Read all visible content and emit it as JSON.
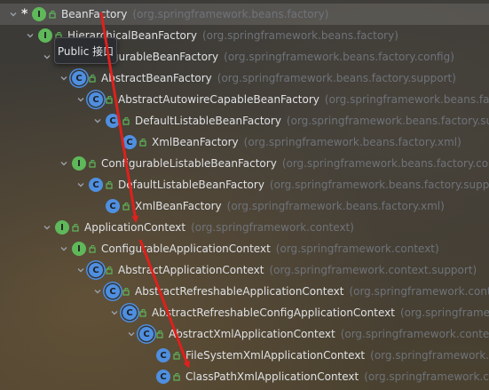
{
  "tooltip": {
    "text": "Public 接口"
  },
  "tree": [
    {
      "indent": 0,
      "chevron": "down",
      "star": true,
      "icon": "interface",
      "name": "BeanFactory",
      "package": "(org.springframework.beans.factory)",
      "selected": true
    },
    {
      "indent": 1,
      "chevron": "down",
      "star": false,
      "icon": "interface",
      "name": "HierarchicalBeanFactory",
      "package": "(org.springframework.beans.factory)",
      "selected": false
    },
    {
      "indent": 2,
      "chevron": "down",
      "star": false,
      "icon": "interface",
      "name": "ConfigurableBeanFactory",
      "package": "(org.springframework.beans.factory.config)",
      "selected": false
    },
    {
      "indent": 3,
      "chevron": "down",
      "star": false,
      "icon": "abstract",
      "name": "AbstractBeanFactory",
      "package": "(org.springframework.beans.factory.support)",
      "selected": false
    },
    {
      "indent": 4,
      "chevron": "down",
      "star": false,
      "icon": "abstract",
      "name": "AbstractAutowireCapableBeanFactory",
      "package": "(org.springframework.beans.factory.support)",
      "selected": false
    },
    {
      "indent": 5,
      "chevron": "down",
      "star": false,
      "icon": "class",
      "name": "DefaultListableBeanFactory",
      "package": "(org.springframework.beans.factory.support)",
      "selected": false
    },
    {
      "indent": 6,
      "chevron": "none",
      "star": false,
      "icon": "class",
      "name": "XmlBeanFactory",
      "package": "(org.springframework.beans.factory.xml)",
      "selected": false
    },
    {
      "indent": 3,
      "chevron": "down",
      "star": false,
      "icon": "interface",
      "name": "ConfigurableListableBeanFactory",
      "package": "(org.springframework.beans.factory.config)",
      "selected": false
    },
    {
      "indent": 4,
      "chevron": "down",
      "star": false,
      "icon": "class",
      "name": "DefaultListableBeanFactory",
      "package": "(org.springframework.beans.factory.support)",
      "selected": false
    },
    {
      "indent": 5,
      "chevron": "none",
      "star": false,
      "icon": "class",
      "name": "XmlBeanFactory",
      "package": "(org.springframework.beans.factory.xml)",
      "selected": false
    },
    {
      "indent": 2,
      "chevron": "down",
      "star": false,
      "icon": "interface",
      "name": "ApplicationContext",
      "package": "(org.springframework.context)",
      "selected": false
    },
    {
      "indent": 3,
      "chevron": "down",
      "star": false,
      "icon": "interface",
      "name": "ConfigurableApplicationContext",
      "package": "(org.springframework.context)",
      "selected": false
    },
    {
      "indent": 4,
      "chevron": "down",
      "star": false,
      "icon": "abstract",
      "name": "AbstractApplicationContext",
      "package": "(org.springframework.context.support)",
      "selected": false
    },
    {
      "indent": 5,
      "chevron": "down",
      "star": false,
      "icon": "abstract",
      "name": "AbstractRefreshableApplicationContext",
      "package": "(org.springframework.context.support)",
      "selected": false
    },
    {
      "indent": 6,
      "chevron": "down",
      "star": false,
      "icon": "abstract",
      "name": "AbstractRefreshableConfigApplicationContext",
      "package": "(org.springframework.context.support)",
      "selected": false
    },
    {
      "indent": 7,
      "chevron": "down",
      "star": false,
      "icon": "abstract",
      "name": "AbstractXmlApplicationContext",
      "package": "(org.springframework.context.support)",
      "selected": false
    },
    {
      "indent": 8,
      "chevron": "none",
      "star": false,
      "icon": "class",
      "name": "FileSystemXmlApplicationContext",
      "package": "(org.springframework.context.support)",
      "selected": false
    },
    {
      "indent": 8,
      "chevron": "none",
      "star": false,
      "icon": "class",
      "name": "ClassPathXmlApplicationContext",
      "package": "(org.springframework.context.support)",
      "selected": false
    }
  ],
  "colors": {
    "annotation_arrow": "#e0201c",
    "interface_icon": "#5fb85a",
    "class_icon": "#4f8fe0"
  }
}
